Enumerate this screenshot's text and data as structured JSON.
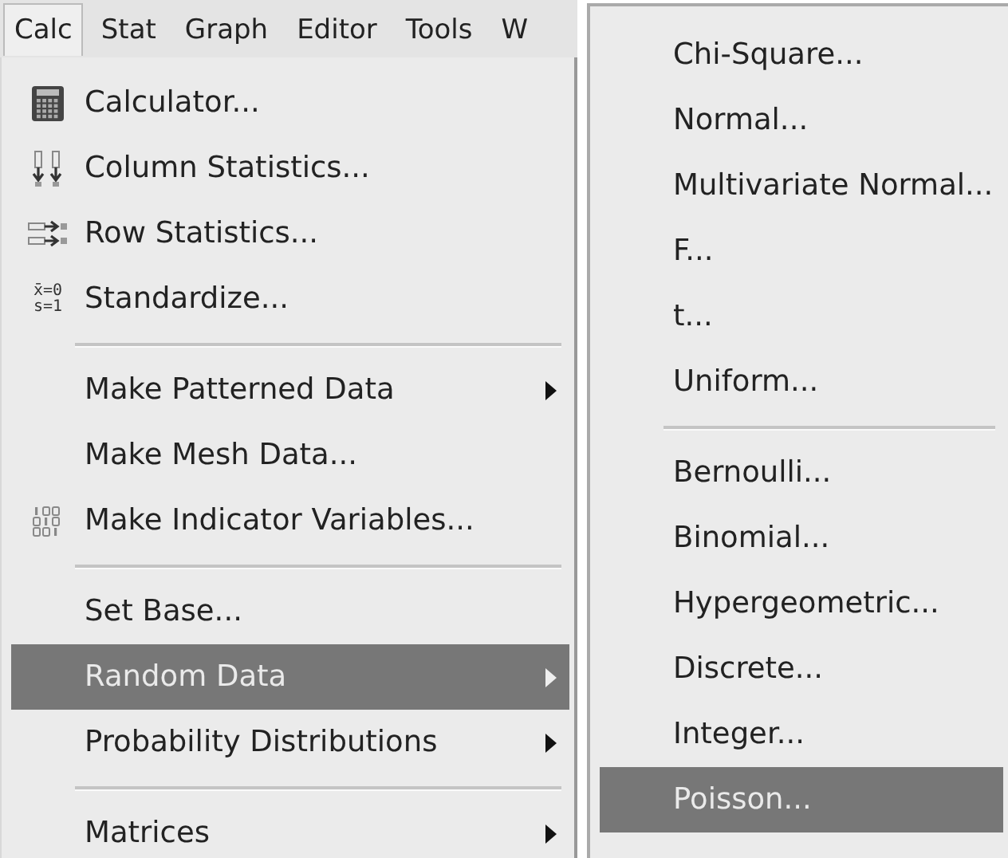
{
  "menubar": [
    {
      "label": "Calc",
      "selected": true
    },
    {
      "label": "Stat",
      "selected": false
    },
    {
      "label": "Graph",
      "selected": false
    },
    {
      "label": "Editor",
      "selected": false
    },
    {
      "label": "Tools",
      "selected": false
    },
    {
      "label": "W",
      "selected": false
    }
  ],
  "calc_menu": [
    {
      "kind": "calculator",
      "label": "Calculator...",
      "selected": false,
      "submenu": false
    },
    {
      "kind": "columnstats",
      "label": "Column Statistics...",
      "selected": false,
      "submenu": false
    },
    {
      "kind": "rowstats",
      "label": "Row Statistics...",
      "selected": false,
      "submenu": false
    },
    {
      "kind": "standardize",
      "icon_text": [
        "x̄=0",
        "s=1"
      ],
      "label": "Standardize...",
      "selected": false,
      "submenu": false
    },
    {
      "kind": "separator"
    },
    {
      "kind": "plain",
      "label": "Make Patterned Data",
      "selected": false,
      "submenu": true
    },
    {
      "kind": "plain",
      "label": "Make Mesh Data...",
      "selected": false,
      "submenu": false
    },
    {
      "kind": "indicator",
      "label": "Make Indicator Variables...",
      "selected": false,
      "submenu": false
    },
    {
      "kind": "separator"
    },
    {
      "kind": "plain",
      "label": "Set Base...",
      "selected": false,
      "submenu": false
    },
    {
      "kind": "plain",
      "label": "Random Data",
      "selected": true,
      "submenu": true
    },
    {
      "kind": "plain",
      "label": "Probability Distributions",
      "selected": false,
      "submenu": true
    },
    {
      "kind": "separator"
    },
    {
      "kind": "plain",
      "label": "Matrices",
      "selected": false,
      "submenu": true
    }
  ],
  "random_data_menu": [
    {
      "kind": "plain",
      "label": "Chi-Square...",
      "selected": false
    },
    {
      "kind": "plain",
      "label": "Normal...",
      "selected": false
    },
    {
      "kind": "plain",
      "label": "Multivariate Normal...",
      "selected": false
    },
    {
      "kind": "plain",
      "label": "F...",
      "selected": false
    },
    {
      "kind": "plain",
      "label": "t...",
      "selected": false
    },
    {
      "kind": "plain",
      "label": "Uniform...",
      "selected": false
    },
    {
      "kind": "separator"
    },
    {
      "kind": "plain",
      "label": "Bernoulli...",
      "selected": false
    },
    {
      "kind": "plain",
      "label": "Binomial...",
      "selected": false
    },
    {
      "kind": "plain",
      "label": "Hypergeometric...",
      "selected": false
    },
    {
      "kind": "plain",
      "label": "Discrete...",
      "selected": false
    },
    {
      "kind": "plain",
      "label": "Integer...",
      "selected": false
    },
    {
      "kind": "plain",
      "label": "Poisson...",
      "selected": true
    }
  ]
}
